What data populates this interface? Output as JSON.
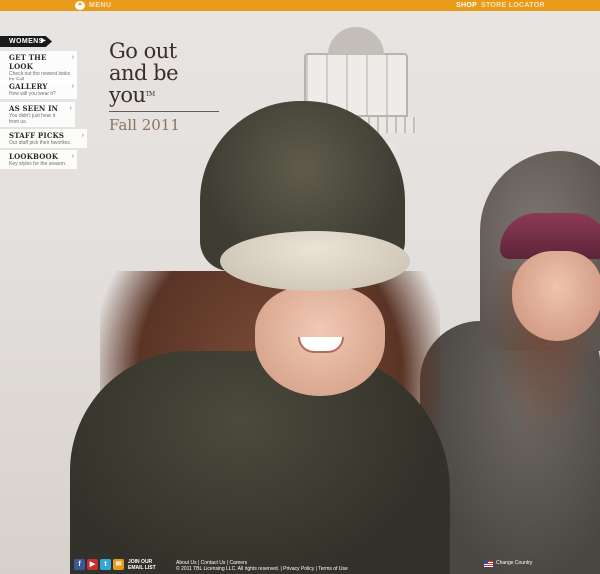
{
  "topbar": {
    "menu_label": "MENU",
    "shop_label": "SHOP",
    "store_locator_label": "STORE LOCATOR",
    "accent_color": "#e89a1a"
  },
  "nav": {
    "section_label": "WOMENS",
    "items": [
      {
        "title": "GET THE LOOK",
        "desc": "Check out the newest looks for Fall."
      },
      {
        "title": "GALLERY",
        "desc": "How will you wear it?"
      },
      {
        "title": "AS SEEN IN",
        "desc": "You didn't just hear it from us."
      },
      {
        "title": "STAFF PICKS",
        "desc": "Our staff pick their favorites."
      },
      {
        "title": "LOOKBOOK",
        "desc": "Key styles for the season."
      }
    ]
  },
  "headline": {
    "line1": "Go out",
    "line2": "and be you",
    "trademark": "TM",
    "season": "Fall 2011"
  },
  "footer": {
    "social_icons": [
      "facebook-icon",
      "youtube-icon",
      "twitter-icon",
      "email-icon"
    ],
    "email_join_label": "JOIN OUR EMAIL LIST",
    "links_line1": "About Us | Contact Us | Careers",
    "links_line2": "© 2011 TBL Licensing LLC. All rights reserved. | Privacy Policy | Terms of Use",
    "change_country_label": "Change Country"
  }
}
